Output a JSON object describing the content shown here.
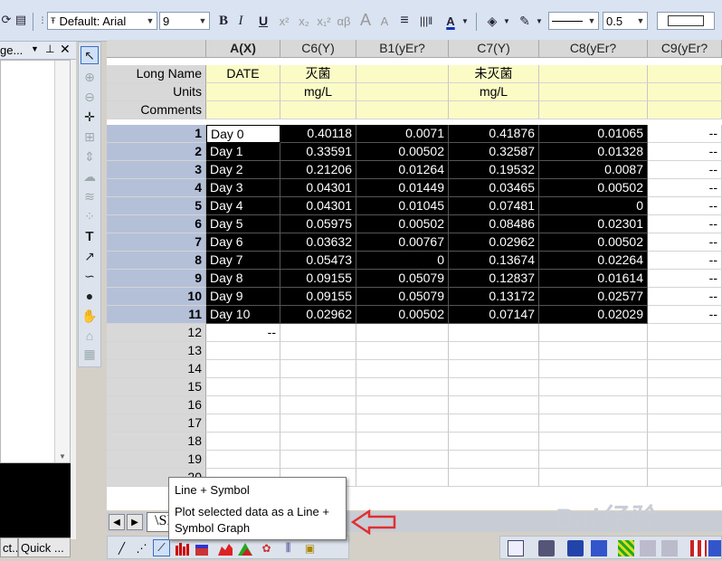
{
  "toolbar": {
    "font_name": "Default: Arial",
    "font_size": "9",
    "bold": "B",
    "italic": "I",
    "underline": "U",
    "superscript": "x²",
    "subscript": "x₂",
    "supsub": "x₁²",
    "greek": "αβ",
    "grow_font": "A",
    "shrink_font": "A",
    "align": "≡",
    "font_color": "A",
    "line_width": "0.5"
  },
  "project_panel": {
    "title": "ge...",
    "tab1": "ct...",
    "tab2": "Quick ..."
  },
  "sheet": {
    "columns": [
      {
        "name": "A(X)"
      },
      {
        "name": "C6(Y)"
      },
      {
        "name": "B1(yEr?"
      },
      {
        "name": "C7(Y)"
      },
      {
        "name": "C8(yEr?"
      },
      {
        "name": "C9(yEr?"
      }
    ],
    "meta_labels": [
      "Long Name",
      "Units",
      "Comments"
    ],
    "long_names": [
      "DATE",
      "灭菌",
      "",
      "未灭菌",
      "",
      ""
    ],
    "units": [
      "",
      "mg/L",
      "",
      "mg/L",
      "",
      ""
    ],
    "rows": [
      {
        "n": "1",
        "v": [
          "Day 0",
          "0.40118",
          "0.0071",
          "0.41876",
          "0.01065",
          "--"
        ]
      },
      {
        "n": "2",
        "v": [
          "Day 1",
          "0.33591",
          "0.00502",
          "0.32587",
          "0.01328",
          "--"
        ]
      },
      {
        "n": "3",
        "v": [
          "Day 2",
          "0.21206",
          "0.01264",
          "0.19532",
          "0.0087",
          "--"
        ]
      },
      {
        "n": "4",
        "v": [
          "Day 3",
          "0.04301",
          "0.01449",
          "0.03465",
          "0.00502",
          "--"
        ]
      },
      {
        "n": "5",
        "v": [
          "Day 4",
          "0.04301",
          "0.01045",
          "0.07481",
          "0",
          "--"
        ]
      },
      {
        "n": "6",
        "v": [
          "Day 5",
          "0.05975",
          "0.00502",
          "0.08486",
          "0.02301",
          "--"
        ]
      },
      {
        "n": "7",
        "v": [
          "Day 6",
          "0.03632",
          "0.00767",
          "0.02962",
          "0.00502",
          "--"
        ]
      },
      {
        "n": "8",
        "v": [
          "Day 7",
          "0.05473",
          "0",
          "0.13674",
          "0.02264",
          "--"
        ]
      },
      {
        "n": "9",
        "v": [
          "Day 8",
          "0.09155",
          "0.05079",
          "0.12837",
          "0.01614",
          "--"
        ]
      },
      {
        "n": "10",
        "v": [
          "Day 9",
          "0.09155",
          "0.05079",
          "0.13172",
          "0.02577",
          "--"
        ]
      },
      {
        "n": "11",
        "v": [
          "Day 10",
          "0.02962",
          "0.00502",
          "0.07147",
          "0.02029",
          "--"
        ]
      },
      {
        "n": "12",
        "v": [
          "--",
          "",
          "",
          "",
          "",
          ""
        ]
      },
      {
        "n": "13",
        "v": [
          "",
          "",
          "",
          "",
          "",
          ""
        ]
      },
      {
        "n": "14",
        "v": [
          "",
          "",
          "",
          "",
          "",
          ""
        ]
      },
      {
        "n": "15",
        "v": [
          "",
          "",
          "",
          "",
          "",
          ""
        ]
      },
      {
        "n": "16",
        "v": [
          "",
          "",
          "",
          "",
          "",
          ""
        ]
      },
      {
        "n": "17",
        "v": [
          "",
          "",
          "",
          "",
          "",
          ""
        ]
      },
      {
        "n": "18",
        "v": [
          "",
          "",
          "",
          "",
          "",
          ""
        ]
      },
      {
        "n": "19",
        "v": [
          "",
          "",
          "",
          "",
          "",
          ""
        ]
      },
      {
        "n": "20",
        "v": [
          "",
          "",
          "",
          "",
          "",
          ""
        ]
      }
    ],
    "sheet_tab": "Sl"
  },
  "tooltip": {
    "title": "Line + Symbol",
    "description": "Plot selected data as a Line + Symbol Graph"
  },
  "watermark": "Bai经验",
  "colors": {
    "selection": "#000000",
    "row_header_selected": "#b4c0d8",
    "label_row_yellow": "#fbfbc6",
    "callout_arrow": "#e03030"
  }
}
